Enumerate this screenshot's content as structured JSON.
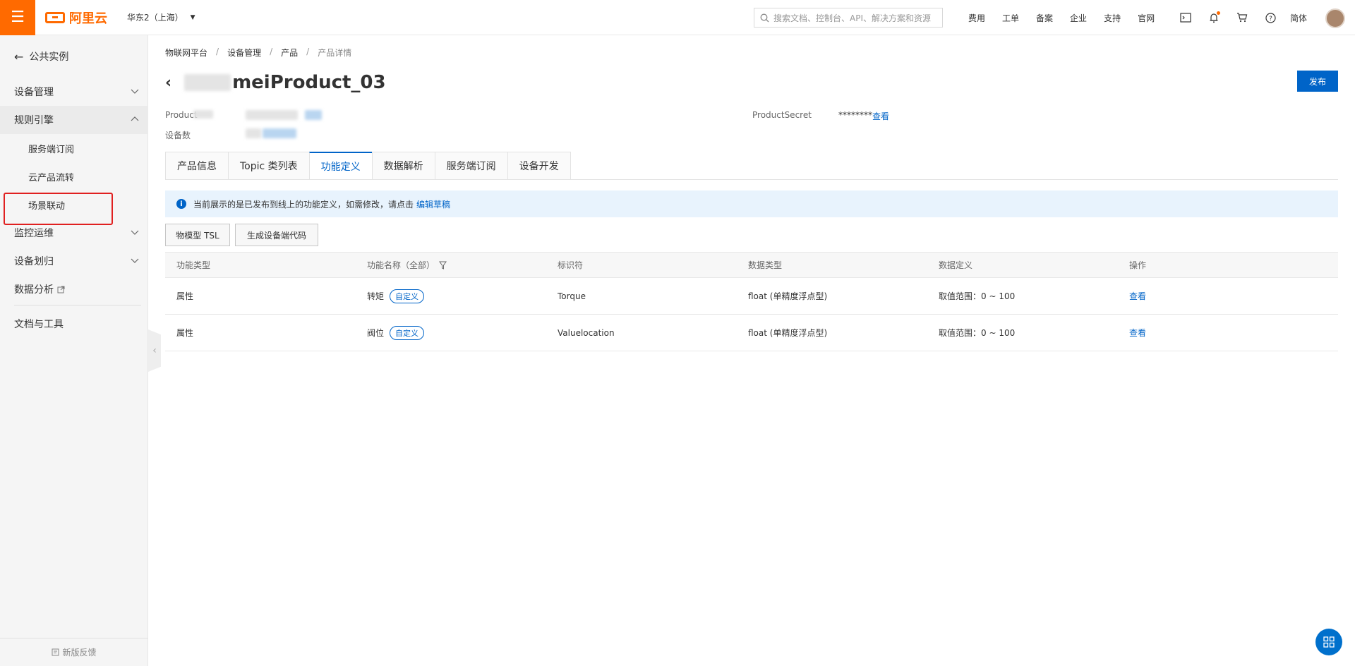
{
  "topbar": {
    "logo_text": "阿里云",
    "region": "华东2（上海）",
    "search_placeholder": "搜索文档、控制台、API、解决方案和资源",
    "links": [
      "费用",
      "工单",
      "备案",
      "企业",
      "支持",
      "官网"
    ],
    "lang": "简体",
    "accent": "#ff6a00"
  },
  "sidebar": {
    "back_label": "公共实例",
    "items": [
      {
        "label": "设备管理"
      },
      {
        "label": "规则引擎"
      },
      {
        "label": "服务端订阅"
      },
      {
        "label": "云产品流转"
      },
      {
        "label": "场景联动"
      },
      {
        "label": "监控运维"
      },
      {
        "label": "设备划归"
      },
      {
        "label": "数据分析"
      },
      {
        "label": "文档与工具"
      }
    ],
    "feedback": "新版反馈"
  },
  "breadcrumb": [
    "物联网平台",
    "设备管理",
    "产品",
    "产品详情"
  ],
  "page": {
    "title": "meiProduct_03",
    "publish_label": "发布",
    "product_key_label": "Product",
    "device_count_label": "设备数",
    "product_secret_label": "ProductSecret",
    "product_secret_value": "********",
    "view_label": "查看"
  },
  "tabs": [
    "产品信息",
    "Topic 类列表",
    "功能定义",
    "数据解析",
    "服务端订阅",
    "设备开发"
  ],
  "notice": {
    "text": "当前展示的是已发布到线上的功能定义，如需修改，请点击",
    "link": "编辑草稿"
  },
  "buttons": {
    "tsl": "物模型 TSL",
    "gen_code": "生成设备端代码"
  },
  "table": {
    "headers": [
      "功能类型",
      "功能名称（全部）",
      "标识符",
      "数据类型",
      "数据定义",
      "操作"
    ],
    "rows": [
      {
        "type": "属性",
        "name": "转矩",
        "tag": "自定义",
        "identifier": "Torque",
        "data_type": "float (单精度浮点型)",
        "definition": "取值范围：0 ~ 100",
        "action": "查看"
      },
      {
        "type": "属性",
        "name": "阀位",
        "tag": "自定义",
        "identifier": "Valuelocation",
        "data_type": "float (单精度浮点型)",
        "definition": "取值范围：0 ~ 100",
        "action": "查看"
      }
    ]
  }
}
